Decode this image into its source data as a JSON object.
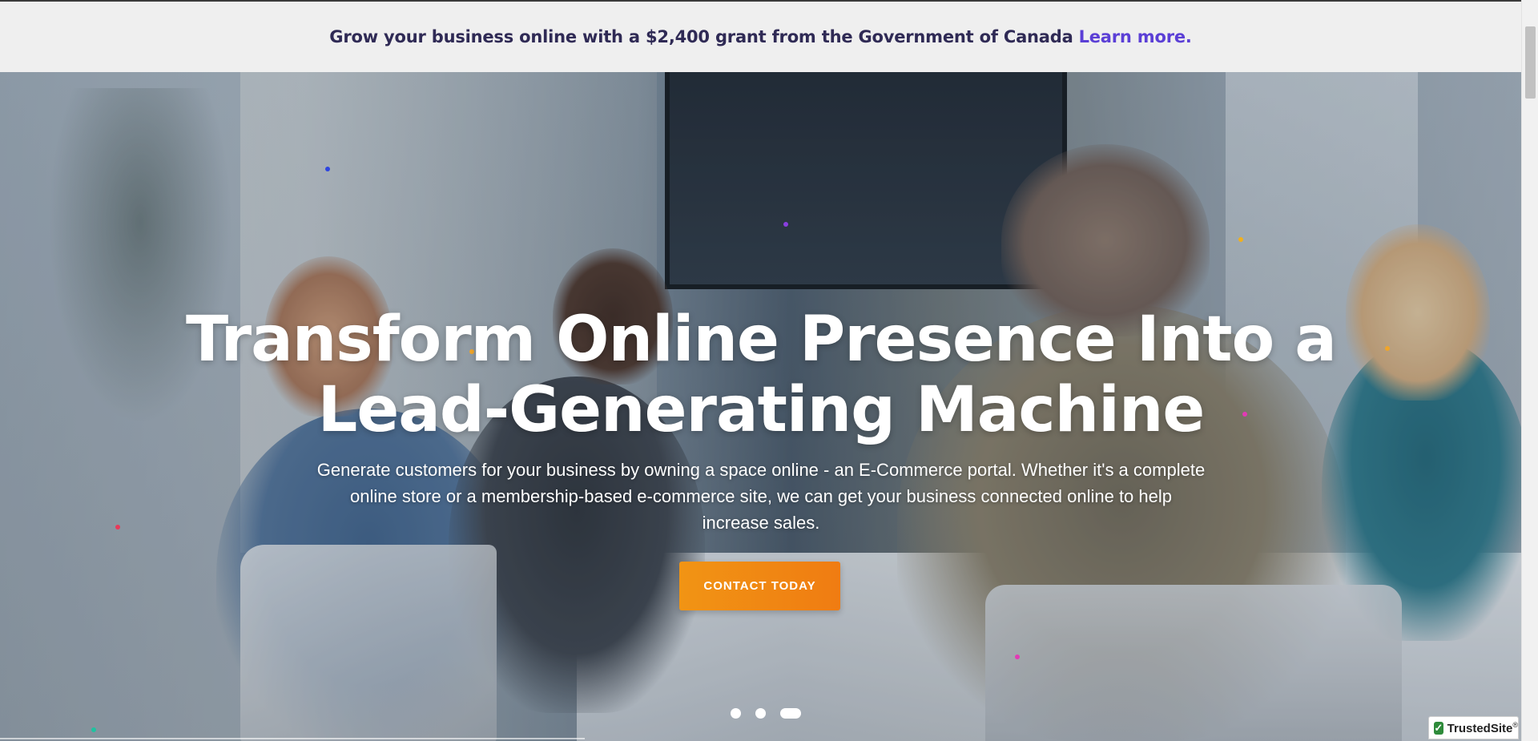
{
  "announcement": {
    "text": "Grow your business online with a $2,400 grant from the Government of Canada",
    "link_label": "Learn more."
  },
  "hero": {
    "headline_line1": "Transform Online Presence Into a",
    "headline_line2": "Lead-Generating Machine",
    "subtext": "Generate customers for your business by owning a space online - an E-Commerce portal. Whether it's a complete online store or a membership-based e-commerce site, we can get your business connected online to help increase sales.",
    "cta_label": "CONTACT TODAY",
    "slider": {
      "slide_count": 3,
      "active_index": 2
    }
  },
  "badge": {
    "check_icon": "check-icon",
    "label": "TrustedSite",
    "mark": "®"
  },
  "colors": {
    "announcement_bg": "#efefef",
    "announcement_text": "#2f2a55",
    "link": "#5b3fd6",
    "cta_gradient_start": "#f19414",
    "cta_gradient_end": "#f07c12",
    "particles": [
      "#1fc2a0",
      "#2d45e0",
      "#8a3fe0",
      "#f2b01b",
      "#f0a52a",
      "#e83a5a",
      "#e23ab5",
      "#f0a52a",
      "#e23ab5"
    ]
  }
}
